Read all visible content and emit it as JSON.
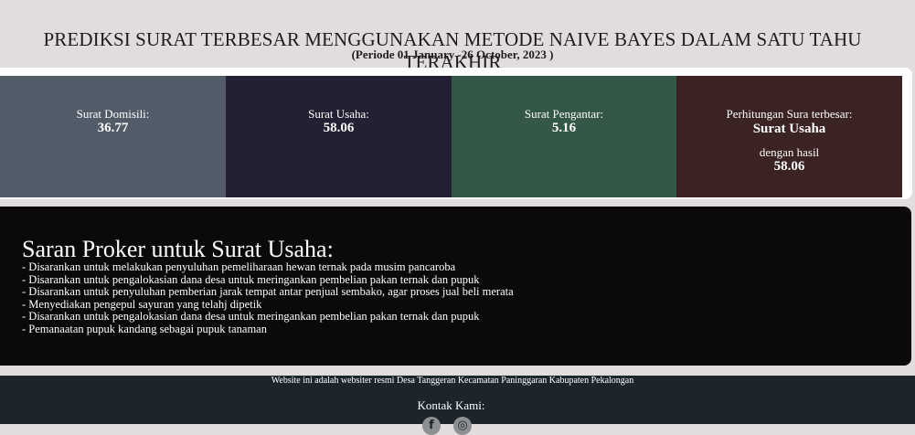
{
  "header": {
    "title": "PREDIKSI SURAT TERBESAR MENGGUNAKAN METODE NAIVE BAYES DALAM SATU TAHU TERAKHIR",
    "period": "(Periode 01 January -26 October, 2023 )"
  },
  "cards": [
    {
      "label": "Surat Domisili:",
      "value": "36.77",
      "color": "#515c68"
    },
    {
      "label": "Surat Usaha:",
      "value": "58.06",
      "color": "#241f33"
    },
    {
      "label": "Surat Pengantar:",
      "value": "5.16",
      "color": "#345747"
    }
  ],
  "result_card": {
    "label": "Perhitungan Sura terbesar:",
    "winner": "Surat Usaha",
    "result_label": "dengan hasil",
    "result_value": "58.06",
    "color": "#3b2223"
  },
  "advice": {
    "title": "Saran Proker untuk Surat Usaha:",
    "items": [
      "- Disarankan untuk melakukan penyuluhan pemeliharaan hewan ternak pada musim pancaroba",
      "- Disarankan untuk pengalokasian dana desa untuk meringankan pembelian pakan ternak dan pupuk",
      "- Disarankan untuk penyuluhan pemberian jarak tempat antar penjual sembako, agar proses jual beli merata",
      "- Menyediakan pengepul sayuran yang telahj dipetik",
      "- Disarankan untuk pengalokasian dana desa untuk meringankan pembelian pakan ternak dan pupuk",
      "- Pemanaatan pupuk kandang sebagai pupuk tanaman"
    ]
  },
  "footer": {
    "note": "Website ini adalah websiter resmi Desa Tanggeran Kecamatan Paninggaran Kabupaten Pekalongan",
    "contact_label": "Kontak Kami:",
    "icons": [
      "facebook-icon",
      "instagram-icon"
    ]
  }
}
